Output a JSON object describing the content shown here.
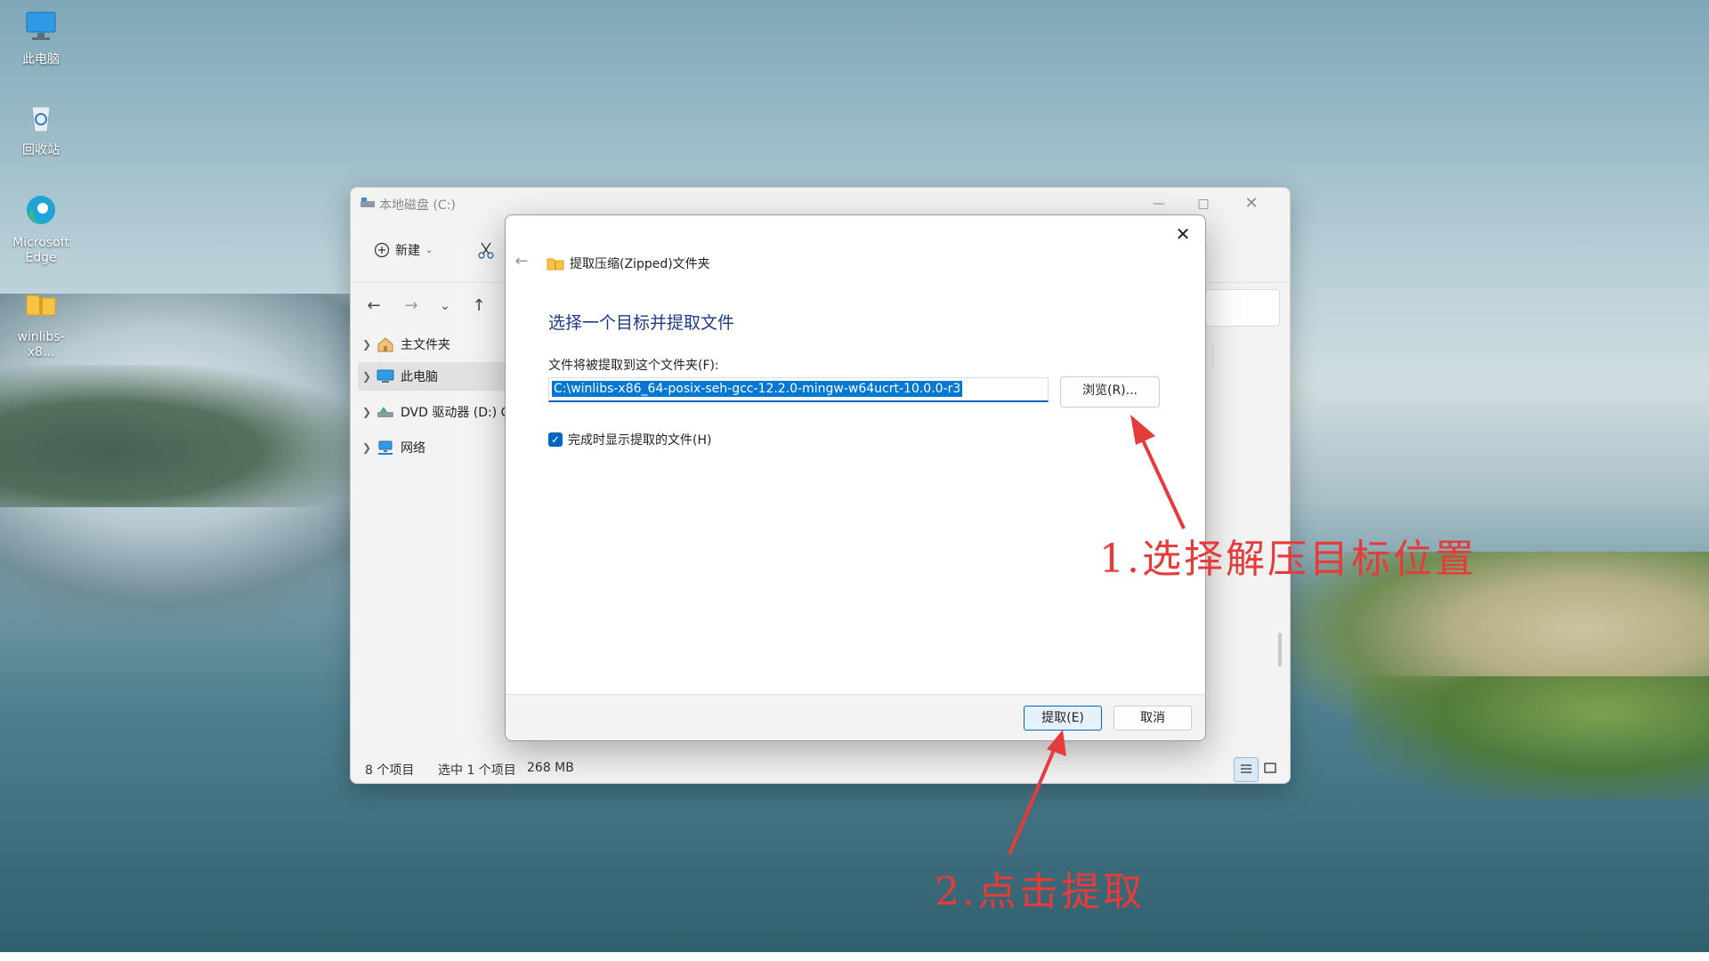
{
  "desktop": {
    "icons": [
      {
        "label": "此电脑",
        "icon": "computer-icon"
      },
      {
        "label": "回收站",
        "icon": "recycle-bin-icon"
      },
      {
        "label": "Microsoft Edge",
        "icon": "edge-icon"
      },
      {
        "label": "winlibs-x8...",
        "icon": "zip-folder-icon"
      }
    ]
  },
  "explorer": {
    "title": "本地磁盘 (C:)",
    "toolbar": {
      "new_label": "新建"
    },
    "sidebar": [
      {
        "label": "主文件夹",
        "icon": "home-icon"
      },
      {
        "label": "此电脑",
        "icon": "computer-icon",
        "selected": true
      },
      {
        "label": "DVD 驱动器 (D:) C",
        "icon": "dvd-drive-icon"
      },
      {
        "label": "网络",
        "icon": "network-icon"
      }
    ],
    "status": {
      "items_count": "8 个项目",
      "selection": "选中 1 个项目",
      "size": "268 MB"
    }
  },
  "dialog": {
    "title": "提取压缩(Zipped)文件夹",
    "heading": "选择一个目标并提取文件",
    "path_label": "文件将被提取到这个文件夹(F):",
    "path_value": "C:\\winlibs-x86_64-posix-seh-gcc-12.2.0-mingw-w64ucrt-10.0.0-r3",
    "browse_label": "浏览(R)...",
    "show_files_label": "完成时显示提取的文件(H)",
    "show_files_checked": true,
    "extract_label": "提取(E)",
    "cancel_label": "取消"
  },
  "annotations": {
    "step1": "1.选择解压目标位置",
    "step2": "2.点击提取",
    "color": "#e53b3b"
  },
  "colors": {
    "accent": "#0067c0",
    "selection": "#0078d4"
  }
}
